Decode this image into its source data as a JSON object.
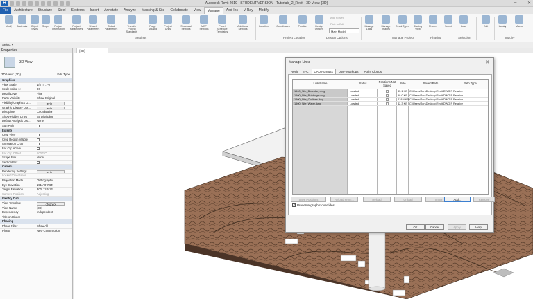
{
  "app": {
    "title": "Autodesk Revit 2019 - STUDENT VERSION - Tutorials_2_Revit - 3D View: {3D}",
    "logo": "R"
  },
  "ribbon_tabs": [
    "File",
    "Architecture",
    "Structure",
    "Steel",
    "Systems",
    "Insert",
    "Annotate",
    "Analyze",
    "Massing & Site",
    "Collaborate",
    "View",
    "Manage",
    "Add-Ins",
    "V-Ray",
    "Modify"
  ],
  "active_tab": "Manage",
  "ribbon": {
    "buttons": [
      "Modify",
      "Materials",
      "Object Styles",
      "Snaps",
      "Project Information",
      "Project Parameters",
      "Shared Parameters",
      "Global Parameters",
      "Transfer Project Standards",
      "Purge Unused",
      "Project Units",
      "Structural Settings",
      "MEP Settings",
      "Panel Schedule Templates",
      "Additional Settings",
      "Location",
      "Coordinates",
      "Position",
      "Design Options",
      "Manage Links",
      "Manage Images",
      "Decal Types",
      "Starting View",
      "Phases",
      "Select",
      "Load",
      "Edit",
      "Inquiry",
      "Macro"
    ],
    "design_option_items": [
      "Add to Set",
      "Pick to Edit",
      "Main Model"
    ],
    "group_labels": [
      "Settings",
      "Project Location",
      "Design Options",
      "Manage Project",
      "Phasing",
      "Selection",
      "Inquiry"
    ],
    "select_label": "Select ▾"
  },
  "properties": {
    "header": "Properties",
    "type_name": "3D View",
    "instance": "3D View: {3D}",
    "edit_type": "Edit Type",
    "rows": [
      {
        "k": "Graphics",
        "v": "",
        "sec": true
      },
      {
        "k": "View Scale",
        "v": "1/8\" = 1'-0\""
      },
      {
        "k": "Scale Value  1:",
        "v": "96"
      },
      {
        "k": "Detail Level",
        "v": "Fine"
      },
      {
        "k": "Parts Visibility",
        "v": "Show Original"
      },
      {
        "k": "Visibility/Graphics O...",
        "v": "Edit...",
        "btn": true
      },
      {
        "k": "Graphic Display Opt...",
        "v": "Edit...",
        "btn": true
      },
      {
        "k": "Discipline",
        "v": "Coordination"
      },
      {
        "k": "Show Hidden Lines",
        "v": "By Discipline"
      },
      {
        "k": "Default Analysis Dis...",
        "v": "None"
      },
      {
        "k": "Sun Path",
        "v": "",
        "cb": true
      },
      {
        "k": "Extents",
        "v": "",
        "sec": true
      },
      {
        "k": "Crop View",
        "v": "",
        "cb": true
      },
      {
        "k": "Crop Region Visible",
        "v": "",
        "cb": true
      },
      {
        "k": "Annotation Crop",
        "v": "",
        "cb": true
      },
      {
        "k": "Far Clip Active",
        "v": "",
        "cb": true
      },
      {
        "k": "Far Clip Offset",
        "v": "1000' 0\"",
        "dim": true
      },
      {
        "k": "Scope Box",
        "v": "None"
      },
      {
        "k": "Section Box",
        "v": "✓",
        "cb": true
      },
      {
        "k": "Camera",
        "v": "",
        "sec": true
      },
      {
        "k": "Rendering Settings",
        "v": "Edit...",
        "btn": true
      },
      {
        "k": "Locked Orientation",
        "v": "",
        "dim": true
      },
      {
        "k": "Projection Mode",
        "v": "Orthographic"
      },
      {
        "k": "Eye Elevation",
        "v": "1511' 0 7/64\""
      },
      {
        "k": "Target Elevation",
        "v": "300' 11 5/16\""
      },
      {
        "k": "Camera Position",
        "v": "Adjusting",
        "dim": true
      },
      {
        "k": "Identity Data",
        "v": "",
        "sec": true
      },
      {
        "k": "View Template",
        "v": "<None>",
        "btn": true
      },
      {
        "k": "View Name",
        "v": "{3D}"
      },
      {
        "k": "Dependency",
        "v": "Independent"
      },
      {
        "k": "Title on Sheet",
        "v": ""
      },
      {
        "k": "Phasing",
        "v": "",
        "sec": true
      },
      {
        "k": "Phase Filter",
        "v": "Show All"
      },
      {
        "k": "Phase",
        "v": "New Construction"
      }
    ]
  },
  "view_tab": "{3D}",
  "dialog": {
    "title": "Manage Links",
    "close": "✕",
    "tabs": [
      "Revit",
      "IFC",
      "CAD Formats",
      "DWF Markups",
      "Point Clouds"
    ],
    "active_tab": "CAD Formats",
    "columns": [
      "Link Name",
      "Status",
      "Positions Not Saved",
      "Size",
      "Saved Path",
      "Path Type"
    ],
    "rows": [
      {
        "name": "1500_Site_Boundary.dwg",
        "status": "Loaded",
        "size": "85.1 KB",
        "path": "C:\\Users\\Jon\\Desktop\\Revit DWG Files\\",
        "ptype": "Relative"
      },
      {
        "name": "1500_Site_Buildings.dwg",
        "status": "Loaded",
        "size": "99.0 KB",
        "path": "C:\\Users\\Jon\\Desktop\\Revit DWG Files\\",
        "ptype": "Relative"
      },
      {
        "name": "1500_Site_Outlines.dwg",
        "status": "Loaded",
        "size": "418.4 KB",
        "path": "C:\\Users\\Jon\\Desktop\\Revit DWG Files\\",
        "ptype": "Relative"
      },
      {
        "name": "1500_Site_Water.dwg",
        "status": "Loaded",
        "size": "42.3 KB",
        "path": "C:\\Users\\Jon\\Desktop\\Revit DWG Files\\",
        "ptype": "Relative"
      }
    ],
    "action_buttons": [
      "Save Positions",
      "Reload From...",
      "Reload",
      "Unload",
      "Import",
      "Add...",
      "Remove"
    ],
    "preserve_label": "Preserve graphic overrides",
    "footer_buttons": [
      "OK",
      "Cancel",
      "Apply",
      "Help"
    ]
  }
}
